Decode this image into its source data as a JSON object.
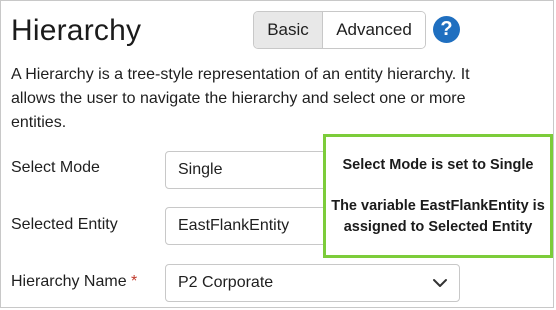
{
  "header": {
    "title": "Hierarchy",
    "modes": {
      "basic": "Basic",
      "advanced": "Advanced",
      "selected": "Basic"
    },
    "help_icon": "?"
  },
  "description": "A Hierarchy is a tree-style representation of an entity hierarchy. It allows the user to navigate the hierarchy and select one or more entities.",
  "form": {
    "select_mode": {
      "label": "Select Mode",
      "value": "Single"
    },
    "selected_entity": {
      "label": "Selected Entity",
      "value": "EastFlankEntity"
    },
    "hierarchy_name": {
      "label": "Hierarchy Name",
      "required_mark": "*",
      "value": "P2 Corporate"
    }
  },
  "callout": {
    "line1": "Select Mode is set to Single",
    "line2": "The variable EastFlankEntity is assigned to Selected Entity",
    "border_color": "#7ccc3a"
  },
  "colors": {
    "accent": "#1f6fc0",
    "required": "#c0392b"
  }
}
